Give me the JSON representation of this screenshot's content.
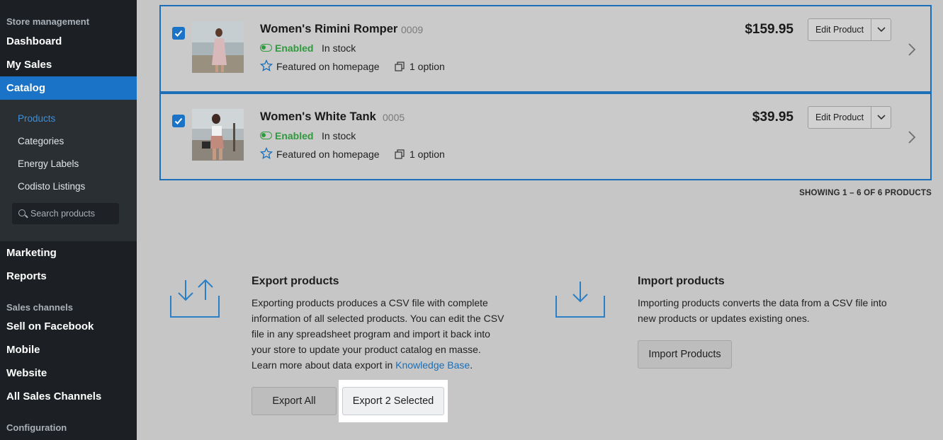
{
  "sidebar": {
    "section_store": "Store management",
    "dashboard": "Dashboard",
    "my_sales": "My Sales",
    "catalog": "Catalog",
    "sub": [
      "Products",
      "Categories",
      "Energy Labels",
      "Codisto Listings"
    ],
    "search_placeholder": "Search products",
    "marketing": "Marketing",
    "reports": "Reports",
    "section_channels": "Sales channels",
    "sell_facebook": "Sell on Facebook",
    "mobile": "Mobile",
    "website": "Website",
    "all_channels": "All Sales Channels",
    "section_config": "Configuration"
  },
  "products": [
    {
      "name": "Women's Rimini Romper",
      "sku": "0009",
      "status": "Enabled",
      "stock": "In stock",
      "featured": "Featured on homepage",
      "options": "1 option",
      "price": "$159.95",
      "edit_label": "Edit Product"
    },
    {
      "name": "Women's White Tank",
      "sku": "0005",
      "status": "Enabled",
      "stock": "In stock",
      "featured": "Featured on homepage",
      "options": "1 option",
      "price": "$39.95",
      "edit_label": "Edit Product"
    }
  ],
  "showing": "SHOWING 1 – 6 OF 6 PRODUCTS",
  "export": {
    "title": "Export products",
    "desc": [
      "Exporting products produces a CSV file with complete",
      "information of all selected products. You can edit the CSV",
      "file in any spreadsheet program and import it back into",
      "your store to update your product catalog en masse."
    ],
    "learn_prefix": "Learn more about data export in ",
    "learn_link": "Knowledge Base",
    "learn_suffix": ".",
    "export_all": "Export All",
    "export_selected": "Export 2 Selected"
  },
  "import": {
    "title": "Import products",
    "desc": [
      "Importing products converts the data from a CSV file into",
      "new products or updates existing ones."
    ],
    "button": "Import Products"
  },
  "colors": {
    "accent": "#1a73c6",
    "enabled": "#2e9a3c",
    "sidebar": "#1c2024"
  }
}
